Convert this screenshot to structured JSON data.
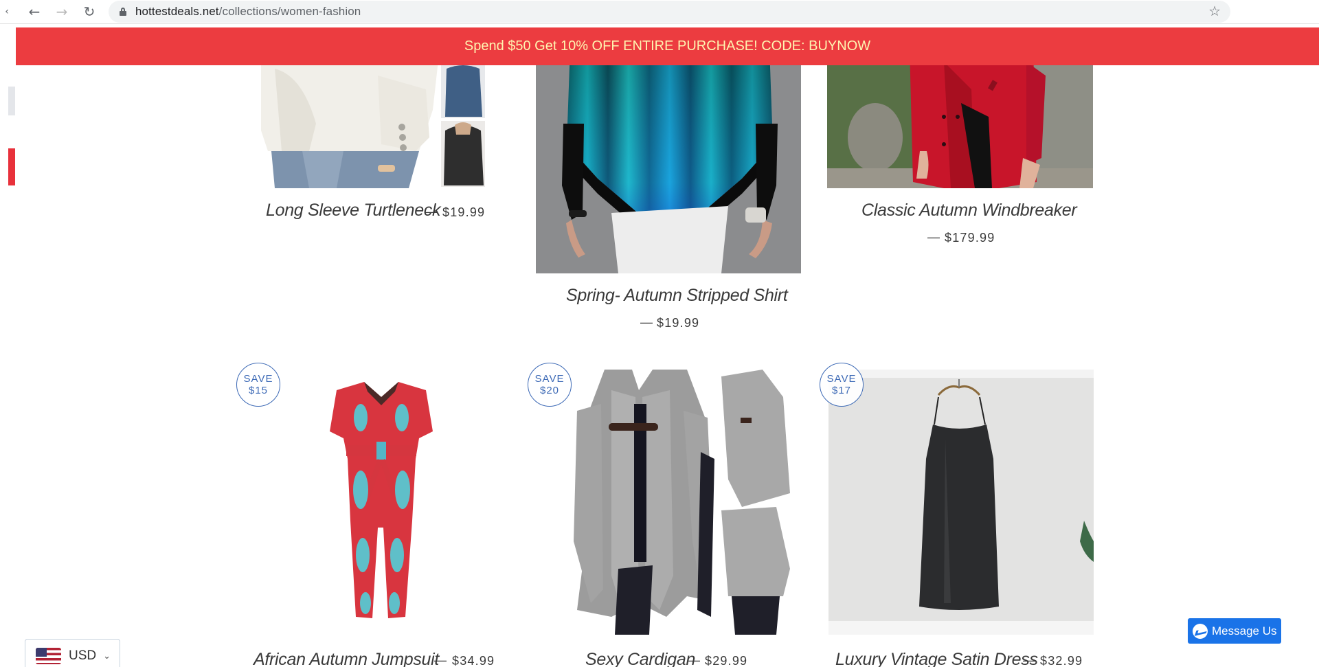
{
  "browser": {
    "back_icon": "back-arrow-icon",
    "forward_icon": "forward-arrow-icon",
    "reload_icon": "reload-icon",
    "url_domain": "hottestdeals.net",
    "url_path": "/collections/women-fashion",
    "bookmark_icon": "star-icon"
  },
  "announcement": {
    "text": "Spend $50 Get 10% OFF ENTIRE PURCHASE! CODE: BUYNOW",
    "bg_color": "#ec3c40",
    "text_color": "#fff4b0"
  },
  "products": [
    {
      "title": "Long Sleeve Turtleneck",
      "price": "$19.99"
    },
    {
      "title": "Spring- Autumn Stripped Shirt",
      "price": "$19.99"
    },
    {
      "title": "Classic Autumn Windbreaker",
      "price": "$179.99"
    },
    {
      "title": "African Autumn Jumpsuit",
      "price": "$34.99",
      "badge_top": "SAVE",
      "badge_bottom": "$15"
    },
    {
      "title": "Sexy Cardigan",
      "price": "$29.99",
      "badge_top": "SAVE",
      "badge_bottom": "$20"
    },
    {
      "title": "Luxury Vintage Satin Dress",
      "price": "$32.99",
      "badge_top": "SAVE",
      "badge_bottom": "$17"
    }
  ],
  "dash": "—",
  "currency": {
    "code": "USD",
    "flag_icon": "us-flag-icon"
  },
  "messenger": {
    "label": "Message Us"
  },
  "colors": {
    "badge": "#3d6ab6",
    "messenger": "#1a73e8"
  }
}
